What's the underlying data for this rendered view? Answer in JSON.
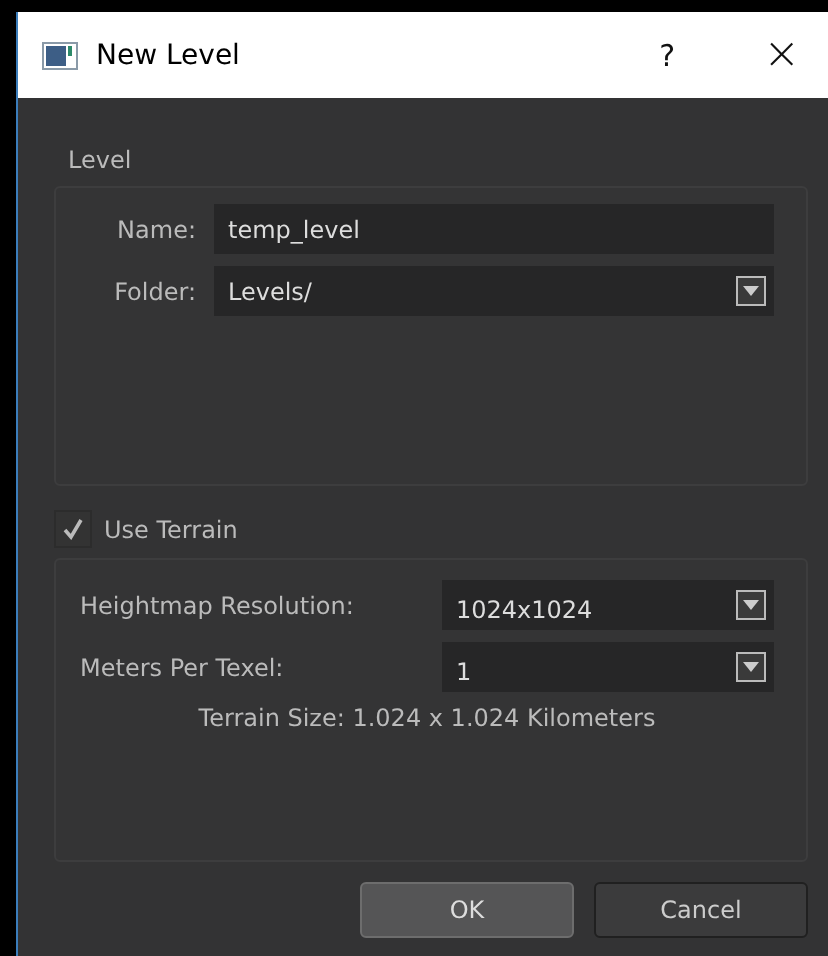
{
  "window": {
    "title": "New Level",
    "help": "?",
    "close": "×"
  },
  "level_group": {
    "title": "Level",
    "fields": [
      {
        "kind": "text",
        "label": "Name:",
        "value": "temp_level"
      },
      {
        "kind": "dropdown",
        "label": "Folder:",
        "value": "Levels/"
      }
    ]
  },
  "use_terrain": {
    "label": "Use Terrain",
    "checked": true
  },
  "terrain_group": {
    "fields": [
      {
        "kind": "dropdown",
        "label": "Heightmap Resolution:",
        "value": "1024x1024"
      },
      {
        "kind": "dropdown",
        "label": "Meters Per Texel:",
        "value": "1"
      }
    ],
    "size_text": "Terrain Size: 1.024 x 1.024 Kilometers"
  },
  "buttons": [
    {
      "label": "OK",
      "kind": "default"
    },
    {
      "label": "Cancel",
      "kind": "normal"
    }
  ]
}
